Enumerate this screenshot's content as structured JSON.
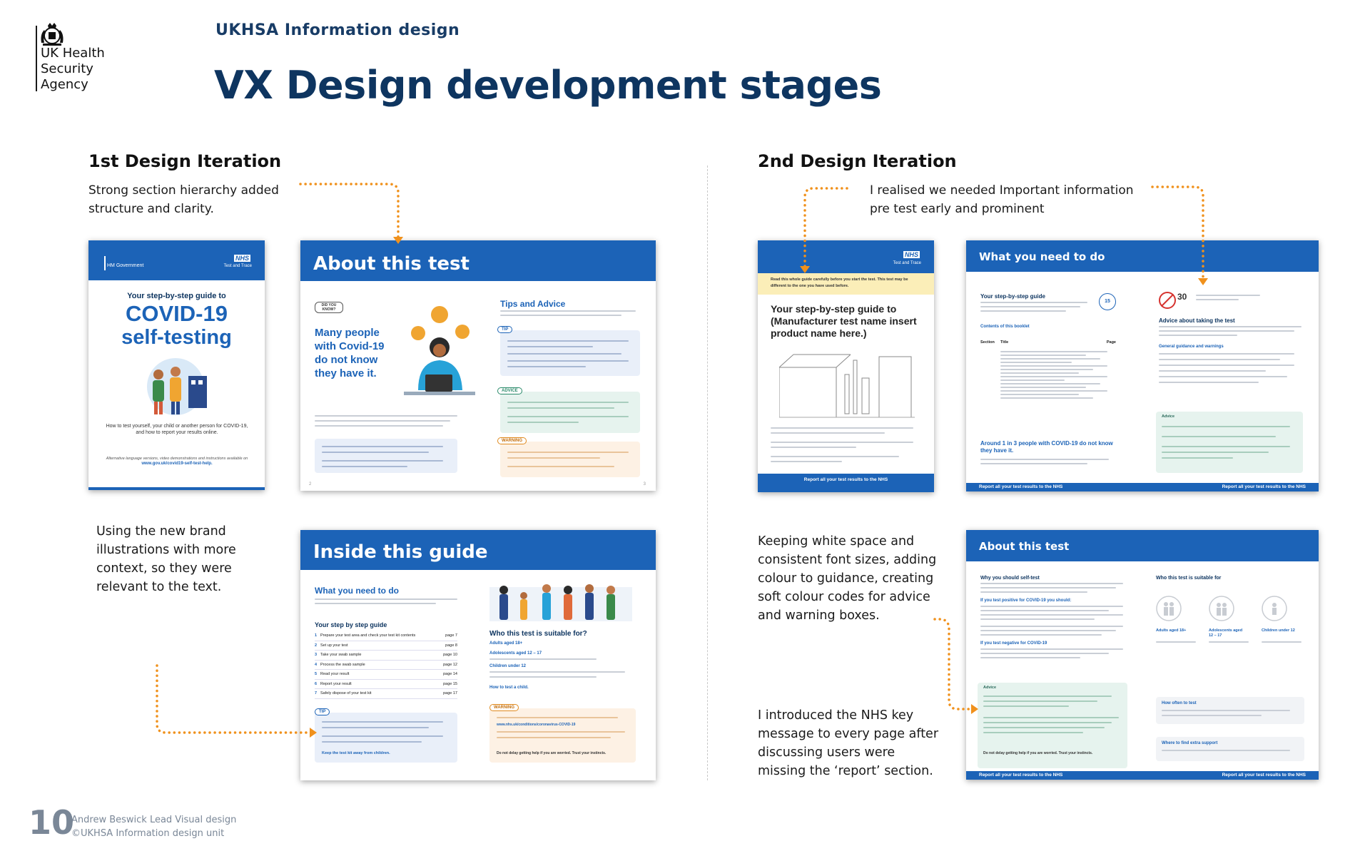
{
  "brand": {
    "agency_lines": [
      "UK Health",
      "Security",
      "Agency"
    ],
    "kicker": "UKHSA Information design"
  },
  "page_title": "VX Design development stages",
  "colors": {
    "navy": "#0e3560",
    "nhs_blue": "#1c63b7",
    "arrow_orange": "#f0911c",
    "footer_grey": "#7a8797"
  },
  "left": {
    "heading": "1st Design Iteration",
    "note_top": "Strong section hierarchy added structure and clarity.",
    "note_bottom": "Using the new brand illustrations with more context, so they were relevant to the text.",
    "cover": {
      "gov": "HM Government",
      "nhs": "NHS",
      "test_and_trace": "Test and Trace",
      "subtitle": "Your step-by-step guide to",
      "title_line1": "COVID-19",
      "title_line2": "self-testing",
      "desc": "How to test yourself, your child or another person for COVID-19, and how to report your results online.",
      "alt": "Alternative language versions, video demonstrations and instructions available on",
      "link": "www.gov.uk/covid19-self-test-help."
    },
    "about": {
      "band": "About this test",
      "did_you_know": "DID YOU KNOW?",
      "stat": "Many people with Covid-19 do not know they have it.",
      "tips_title": "Tips and Advice",
      "tip_tag": "TIP",
      "advice_tag": "ADVICE",
      "warning_tag": "WARNING",
      "page_left": "2",
      "page_right": "3"
    },
    "inside": {
      "band": "Inside this guide",
      "need_title": "What you need to do",
      "steps_title": "Your step by step guide",
      "steps": [
        {
          "n": "1",
          "t": "Prepare your test area and check your test kit contents",
          "p": "page 7"
        },
        {
          "n": "2",
          "t": "Set up your test",
          "p": "page 8"
        },
        {
          "n": "3",
          "t": "Take your swab sample",
          "p": "page 10"
        },
        {
          "n": "4",
          "t": "Process the swab sample",
          "p": "page 12"
        },
        {
          "n": "5",
          "t": "Read your result",
          "p": "page 14"
        },
        {
          "n": "6",
          "t": "Report your result",
          "p": "page 15"
        },
        {
          "n": "7",
          "t": "Safely dispose of your test kit",
          "p": "page 17"
        }
      ],
      "tip_tag": "TIP",
      "tip_link": "Keep the test kit away from children.",
      "who_title": "Who this test is suitable for?",
      "who_adults": "Adults aged 18+",
      "who_adolescents": "Adolescents aged 12 – 17",
      "who_children": "Children under 12",
      "how_to": "How to test a child.",
      "warning_tag": "WARNING",
      "warning_link": "www.nhs.uk/conditions/coronavirus-COVID-19",
      "warning_bold": "Do not delay getting help if you are worried. Trust your instincts."
    }
  },
  "right": {
    "heading": "2nd Design Iteration",
    "note_top": "I realised we needed Important information pre test early and prominent",
    "note_middle": "Keeping white space and consistent font sizes, adding colour to guidance, creating soft colour codes for advice and warning boxes.",
    "note_bottom": "I introduced the NHS key message to every page after discussing users were missing the ‘report’ section.",
    "cover2": {
      "nhs": "NHS",
      "test_and_trace": "Test and Trace",
      "banner": "Read this whole guide carefully before you start the test. This test may be different to the one you have used before.",
      "title": "Your step-by-step guide to (Manufacturer test name insert product name here.)",
      "footer": "Report all your test results to the NHS"
    },
    "need": {
      "band": "What you need to do",
      "guide_title": "Your step-by-step guide",
      "contents": "Contents of this booklet",
      "col_section": "Section",
      "col_title": "Title",
      "col_page": "Page",
      "minutes": "15",
      "thirty": "30",
      "advice_title": "Advice about taking the test",
      "general": "General guidance and warnings",
      "advice_tag": "Advice",
      "stat": "Around 1 in 3 people with COVID-19 do not know they have it.",
      "footer": "Report all your test results to the NHS"
    },
    "about2": {
      "band": "About this test",
      "why": "Why you should self-test",
      "positive": "If you test positive for COVID-19 you should:",
      "negative": "If you test negative for COVID-19",
      "advice_tag": "Advice",
      "who": "Who this test is suitable for",
      "adults": "Adults aged 18+",
      "adolescents": "Adolescents aged 12 – 17",
      "children": "Children under 12",
      "how_often": "How often to test",
      "support": "Where to find extra support",
      "bold_line": "Do not delay getting help if you are worried. Trust your instincts.",
      "footer": "Report all your test results to the NHS"
    }
  },
  "footer": {
    "page_number": "10",
    "credit": "Andrew Beswick Lead Visual design",
    "copyright": "©UKHSA  Information design unit"
  }
}
